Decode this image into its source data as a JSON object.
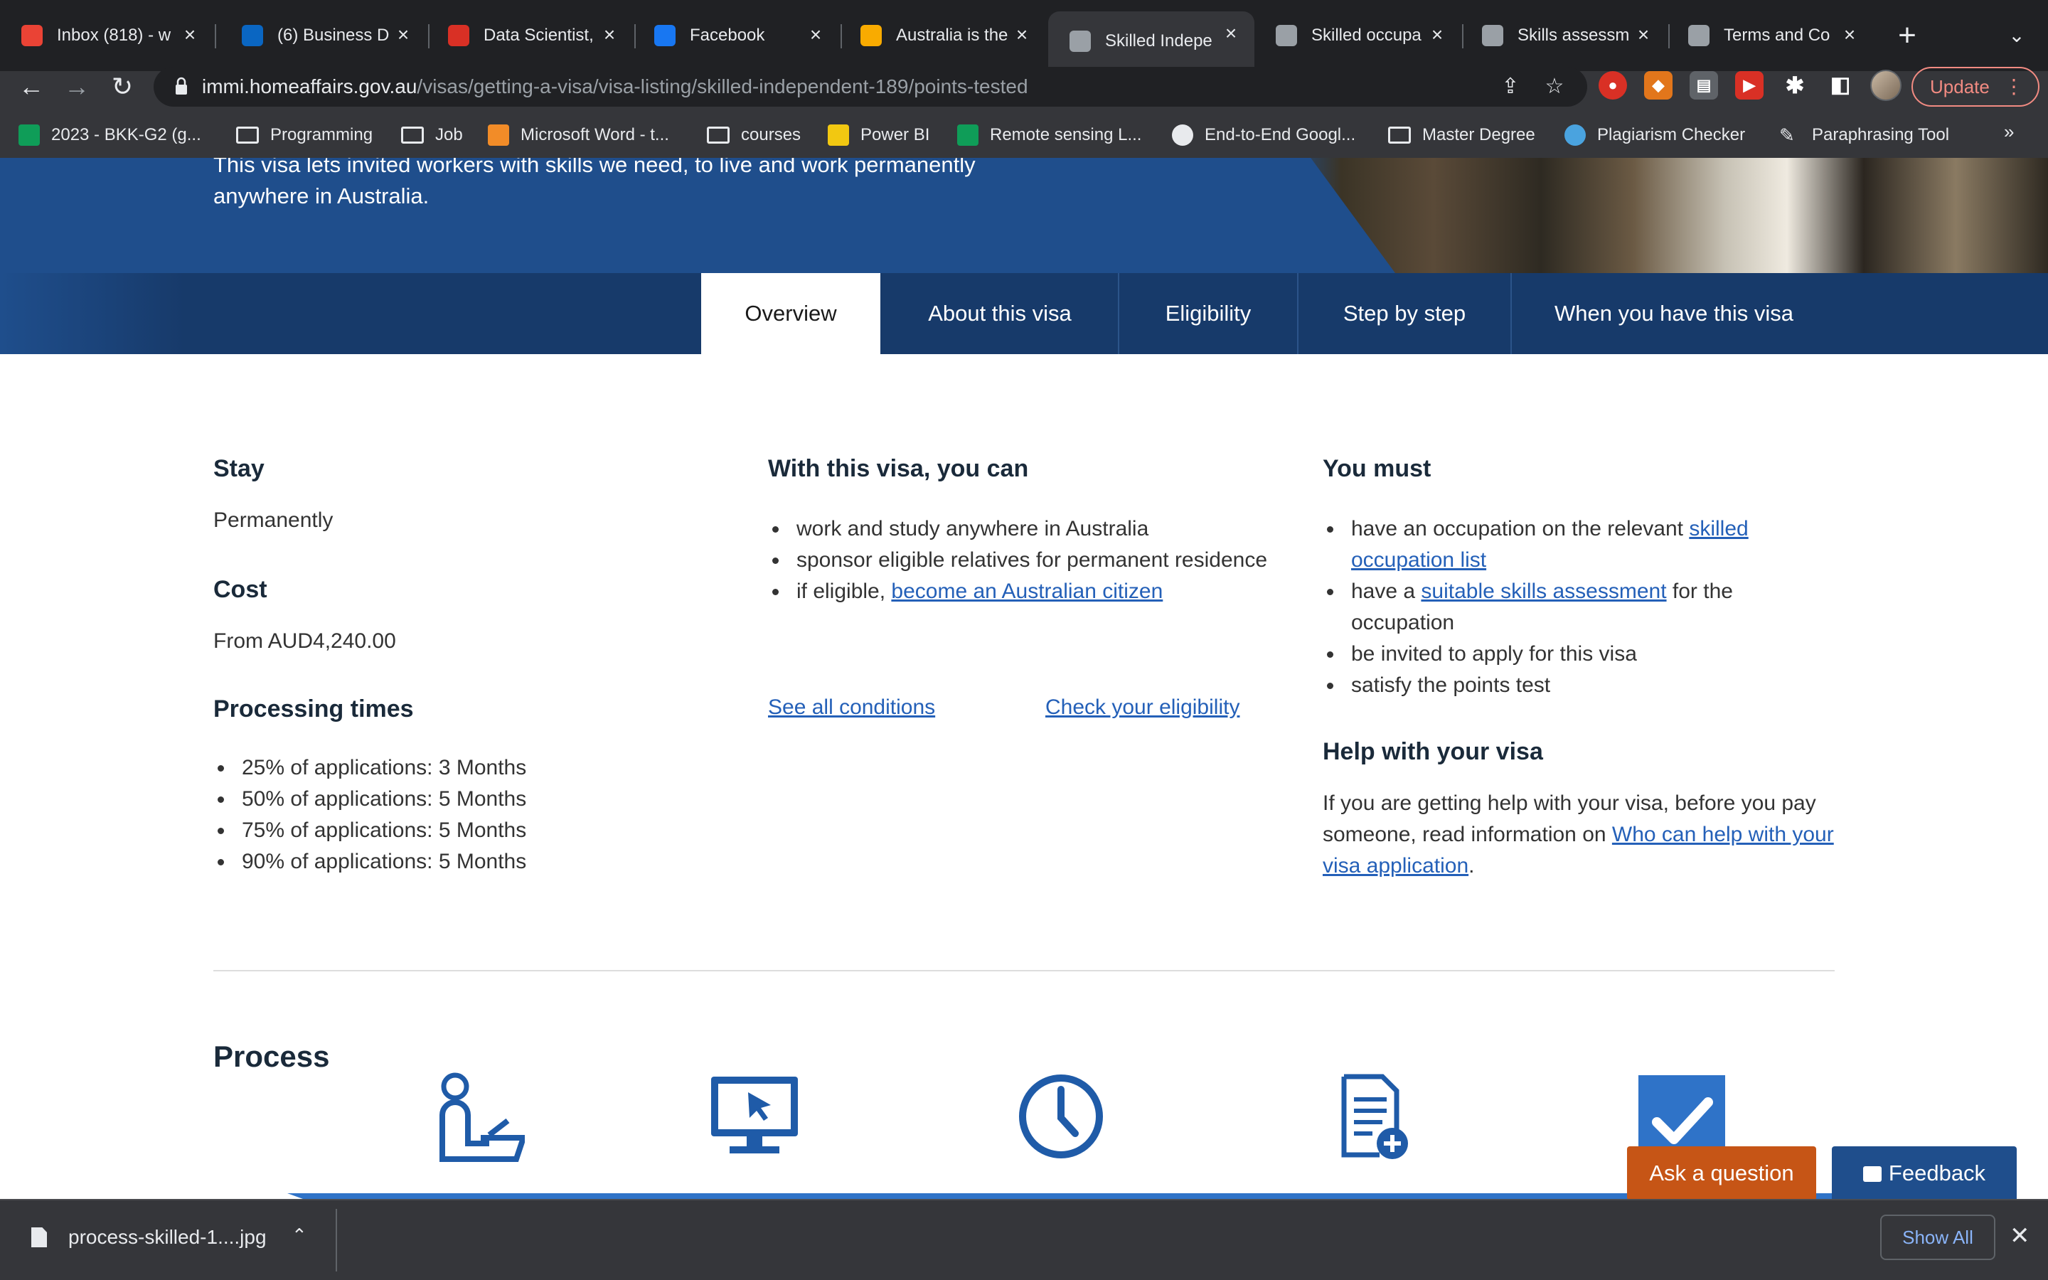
{
  "browser": {
    "tabs": [
      {
        "title": "Inbox (818) - w",
        "icon": "gmail-icon",
        "color": "#ea4335"
      },
      {
        "title": "(6) Business D",
        "icon": "linkedin-icon",
        "color": "#0a66c2"
      },
      {
        "title": "Data Scientist,",
        "icon": "shield-icon",
        "color": "#d93025"
      },
      {
        "title": "Facebook",
        "icon": "facebook-icon",
        "color": "#1877f2"
      },
      {
        "title": "Australia is the",
        "icon": "plane-icon",
        "color": "#f9ab00"
      },
      {
        "title": "Skilled Indepe",
        "icon": "crest-icon",
        "color": "#9aa0a6"
      },
      {
        "title": "Skilled occupa",
        "icon": "crest-icon",
        "color": "#9aa0a6"
      },
      {
        "title": "Skills assessm",
        "icon": "crest-icon",
        "color": "#9aa0a6"
      },
      {
        "title": "Terms and Co",
        "icon": "crest-icon",
        "color": "#9aa0a6"
      }
    ],
    "active_tab": 5,
    "url_host": "immi.homeaffairs.gov.au",
    "url_path": "/visas/getting-a-visa/visa-listing/skilled-independent-189/points-tested",
    "update_label": "Update",
    "bookmarks": [
      {
        "label": "2023 - BKK-G2 (g...",
        "kind": "sheets"
      },
      {
        "label": "Programming",
        "kind": "folder"
      },
      {
        "label": "Job",
        "kind": "folder"
      },
      {
        "label": "Microsoft Word - t...",
        "kind": "page"
      },
      {
        "label": "courses",
        "kind": "folder"
      },
      {
        "label": "Power BI",
        "kind": "powerbi"
      },
      {
        "label": "Remote sensing L...",
        "kind": "sheets"
      },
      {
        "label": "End-to-End Googl...",
        "kind": "globe"
      },
      {
        "label": "Master Degree",
        "kind": "folder"
      },
      {
        "label": "Plagiarism Checker",
        "kind": "checker"
      },
      {
        "label": "Paraphrasing Tool",
        "kind": "pen"
      }
    ]
  },
  "hero": {
    "intro": "This visa lets invited workers with skills we need, to live and work permanently anywhere in Australia."
  },
  "page_tabs": [
    "Overview",
    "About this visa",
    "Eligibility",
    "Step by step",
    "When you have this visa"
  ],
  "left": {
    "stay_heading": "Stay",
    "stay_value": "Permanently",
    "cost_heading": "Cost",
    "cost_value": "From AUD4,240.00",
    "processing_heading": "Processing times",
    "processing": [
      "25% of applications: 3 Months",
      "50% of applications: 5 Months",
      "75% of applications: 5 Months",
      "90% of applications: 5 Months"
    ]
  },
  "middle": {
    "heading": "With this visa, you can",
    "item1": "work and study anywhere in Australia",
    "item2": "sponsor eligible relatives for permanent residence",
    "item3_prefix": "if eligible, ",
    "item3_link": "become an Australian citizen",
    "see_all": "See all conditions",
    "check": "Check your eligibility"
  },
  "right": {
    "heading": "You must",
    "m1_prefix": "have an occupation on the relevant ",
    "m1_link": "skilled occupation list",
    "m2_prefix": "have a ",
    "m2_link": "suitable skills assessment",
    "m2_suffix": " for the occupation",
    "m3": "be invited to apply for this visa",
    "m4": "satisfy the points test",
    "help_heading": "Help with your visa",
    "help_prefix": "If you are getting help with your visa, before you pay someone, read information on ",
    "help_link": "Who can help with your visa application",
    "help_suffix": "."
  },
  "process": {
    "title": "Process"
  },
  "floating": {
    "ask": "Ask a question",
    "feedback": "Feedback"
  },
  "downloads": {
    "file": "process-skilled-1....jpg",
    "show_all": "Show All"
  }
}
